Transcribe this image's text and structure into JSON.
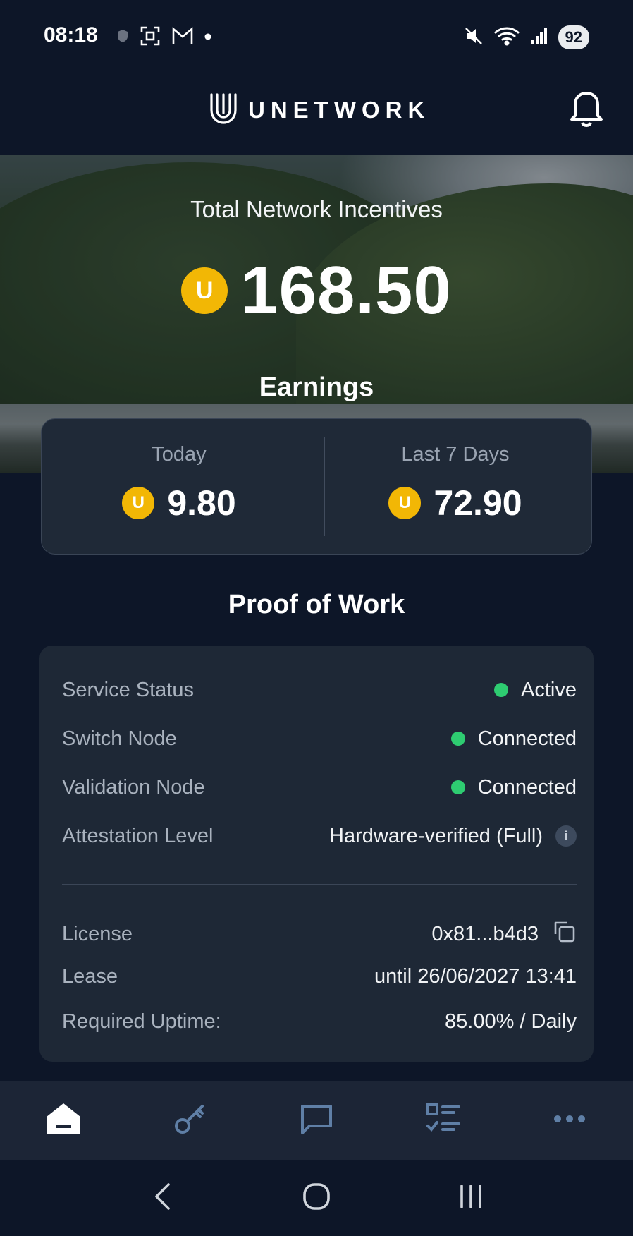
{
  "status_bar": {
    "time": "08:18",
    "battery": "92",
    "icons": [
      "shield-icon",
      "screenshot-icon",
      "gmail-icon",
      "notification-dot-icon",
      "mute-icon",
      "wifi-icon",
      "signal-icon"
    ]
  },
  "app_bar": {
    "brand": "UNETWORK",
    "icons": [
      "unetwork-logo-icon",
      "bell-icon"
    ]
  },
  "hero": {
    "title": "Total Network Incentives",
    "coin_symbol": "U",
    "total": "168.50"
  },
  "earnings": {
    "title": "Earnings",
    "today": {
      "label": "Today",
      "value": "9.80"
    },
    "last7": {
      "label": "Last 7 Days",
      "value": "72.90"
    }
  },
  "proof_of_work": {
    "title": "Proof of Work",
    "status_rows": [
      {
        "label": "Service Status",
        "value": "Active",
        "indicator": "#2ecc71"
      },
      {
        "label": "Switch Node",
        "value": "Connected",
        "indicator": "#2ecc71"
      },
      {
        "label": "Validation Node",
        "value": "Connected",
        "indicator": "#2ecc71"
      },
      {
        "label": "Attestation Level",
        "value": "Hardware-verified (Full)",
        "info_glyph": "i"
      }
    ],
    "license": {
      "label": "License",
      "value": "0x81...b4d3"
    },
    "lease": {
      "label": "Lease",
      "value": "until 26/06/2027 13:41"
    },
    "uptime": {
      "label": "Required Uptime:",
      "value": "85.00% / Daily"
    }
  },
  "bottom_nav": {
    "items": [
      "home-icon",
      "key-icon",
      "chat-icon",
      "tasks-icon",
      "more-icon"
    ],
    "active_color": "#ffffff",
    "inactive_color": "#5f7fa6"
  },
  "system_nav": {
    "items": [
      "back-icon",
      "home-circle-icon",
      "recents-icon"
    ]
  },
  "colors": {
    "background": "#0d1628",
    "card": "#1e2836",
    "coin": "#f2b705",
    "status_green": "#2ecc71"
  }
}
